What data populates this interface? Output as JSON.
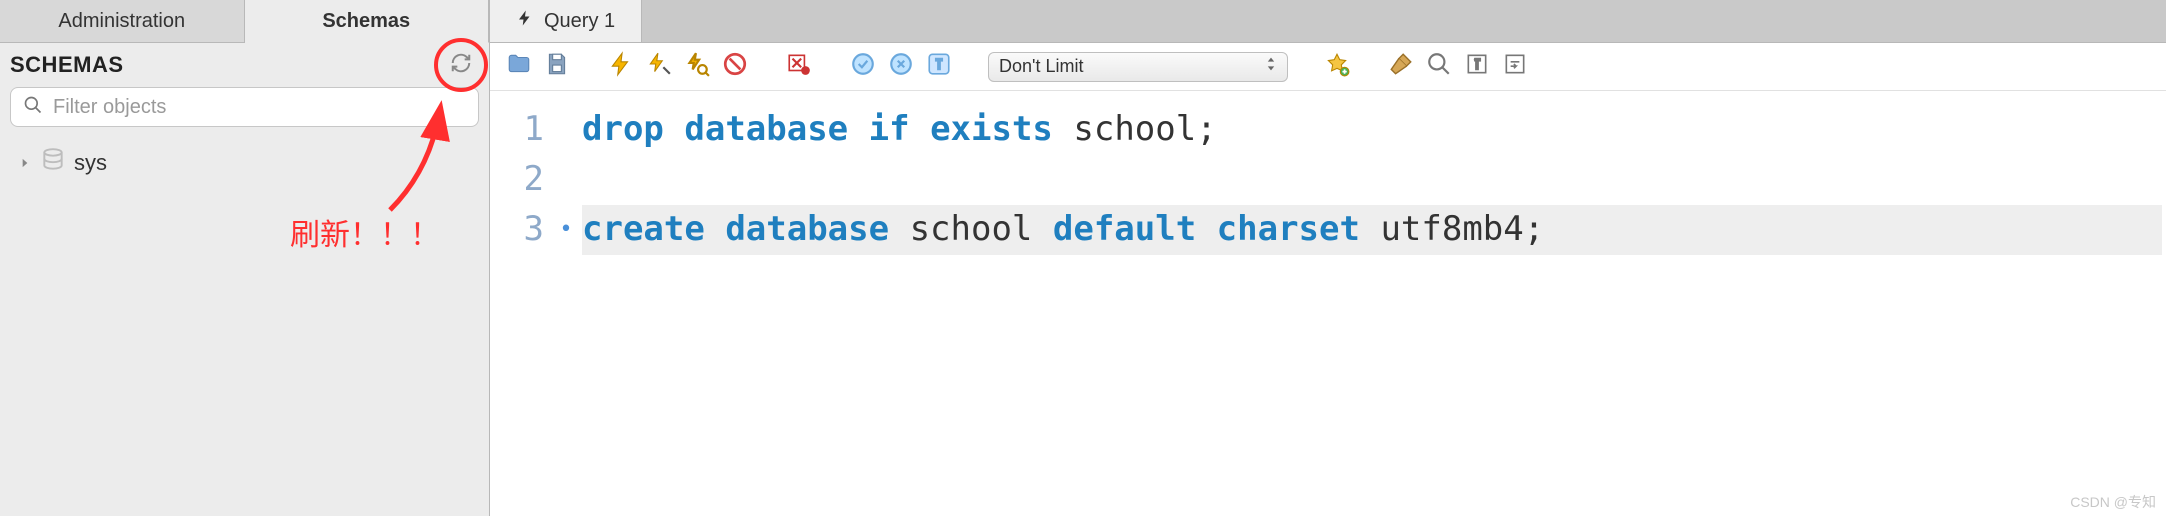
{
  "sidebar": {
    "tabs": {
      "admin": "Administration",
      "schemas": "Schemas"
    },
    "header": "SCHEMAS",
    "search_placeholder": "Filter objects",
    "tree": [
      {
        "label": "sys"
      }
    ]
  },
  "annotations": {
    "refresh_label": "刷新！！！"
  },
  "main": {
    "tab_label": "Query 1",
    "limit_label": "Don't Limit",
    "code": {
      "lines": [
        {
          "n": 1,
          "mark": "",
          "tokens": [
            {
              "t": "drop",
              "c": "kw"
            },
            {
              "t": " ",
              "c": "sp"
            },
            {
              "t": "database",
              "c": "kw"
            },
            {
              "t": " ",
              "c": "sp"
            },
            {
              "t": "if",
              "c": "kw"
            },
            {
              "t": " ",
              "c": "sp"
            },
            {
              "t": "exists",
              "c": "kw"
            },
            {
              "t": " ",
              "c": "sp"
            },
            {
              "t": "school",
              "c": "id"
            },
            {
              "t": ";",
              "c": "pn"
            }
          ]
        },
        {
          "n": 2,
          "mark": "",
          "tokens": []
        },
        {
          "n": 3,
          "mark": "•",
          "hl": true,
          "tokens": [
            {
              "t": "create",
              "c": "kw"
            },
            {
              "t": " ",
              "c": "sp"
            },
            {
              "t": "database",
              "c": "kw"
            },
            {
              "t": " ",
              "c": "sp"
            },
            {
              "t": "school",
              "c": "id"
            },
            {
              "t": " ",
              "c": "sp"
            },
            {
              "t": "default",
              "c": "kw"
            },
            {
              "t": " ",
              "c": "sp"
            },
            {
              "t": "charset",
              "c": "kw"
            },
            {
              "t": " ",
              "c": "sp"
            },
            {
              "t": "utf8mb4",
              "c": "id"
            },
            {
              "t": ";",
              "c": "pn"
            }
          ]
        }
      ]
    }
  },
  "watermark": "CSDN @专知"
}
